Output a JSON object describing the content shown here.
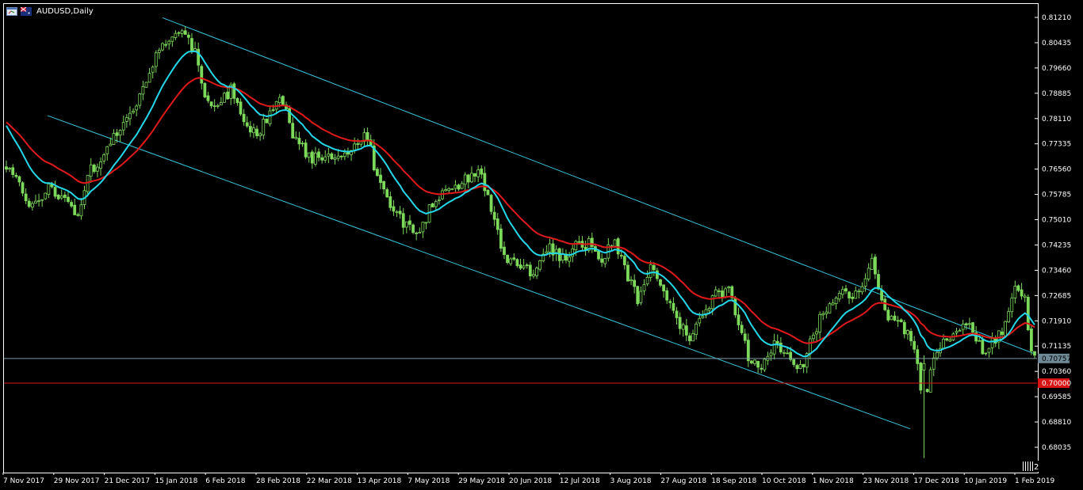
{
  "window": {
    "symbol_title": "AUDUSD,Daily",
    "icons": [
      "chart-window-icon",
      "flag-icon"
    ]
  },
  "colors": {
    "background": "#000000",
    "border": "#ffffff",
    "candle": "#7cd95a",
    "ma_fast": "#24d8ea",
    "ma_slow": "#e01a1a",
    "channel": "#37c6e0",
    "current_price_line": "#7d9aa6",
    "level_line": "#d81414"
  },
  "chart_data": {
    "type": "candlestick",
    "symbol": "AUDUSD",
    "timeframe": "Daily",
    "ylim": [
      0.6755,
      0.816
    ],
    "y_ticks": [
      "0.81210",
      "0.80435",
      "0.79660",
      "0.78885",
      "0.78110",
      "0.77335",
      "0.76560",
      "0.75785",
      "0.75010",
      "0.74235",
      "0.73460",
      "0.72685",
      "0.71910",
      "0.71135",
      "0.70360",
      "0.69585",
      "0.68810",
      "0.68035"
    ],
    "x_labels": [
      "7 Nov 2017",
      "29 Nov 2017",
      "21 Dec 2017",
      "15 Jan 2018",
      "6 Feb 2018",
      "28 Feb 2018",
      "22 Mar 2018",
      "13 Apr 2018",
      "7 May 2018",
      "29 May 2018",
      "20 Jun 2018",
      "12 Jul 2018",
      "3 Aug 2018",
      "27 Aug 2018",
      "18 Sep 2018",
      "10 Oct 2018",
      "1 Nov 2018",
      "23 Nov 2018",
      "17 Dec 2018",
      "10 Jan 2019",
      "1 Feb 2019"
    ],
    "current_price": 0.70757,
    "current_price_label": "0.70757",
    "level_price": 0.7,
    "level_label": "0.70000",
    "price_path": [
      [
        0,
        0.766
      ],
      [
        4,
        0.761
      ],
      [
        8,
        0.754
      ],
      [
        13,
        0.76
      ],
      [
        18,
        0.756
      ],
      [
        22,
        0.75
      ],
      [
        25,
        0.764
      ],
      [
        30,
        0.77
      ],
      [
        36,
        0.78
      ],
      [
        41,
        0.788
      ],
      [
        45,
        0.798
      ],
      [
        50,
        0.806
      ],
      [
        55,
        0.808
      ],
      [
        58,
        0.801
      ],
      [
        61,
        0.787
      ],
      [
        66,
        0.786
      ],
      [
        69,
        0.79
      ],
      [
        72,
        0.782
      ],
      [
        77,
        0.776
      ],
      [
        82,
        0.785
      ],
      [
        85,
        0.787
      ],
      [
        88,
        0.776
      ],
      [
        93,
        0.769
      ],
      [
        99,
        0.77
      ],
      [
        106,
        0.772
      ],
      [
        111,
        0.776
      ],
      [
        114,
        0.762
      ],
      [
        118,
        0.754
      ],
      [
        122,
        0.749
      ],
      [
        126,
        0.745
      ],
      [
        130,
        0.753
      ],
      [
        134,
        0.759
      ],
      [
        138,
        0.76
      ],
      [
        142,
        0.763
      ],
      [
        145,
        0.766
      ],
      [
        149,
        0.754
      ],
      [
        153,
        0.738
      ],
      [
        158,
        0.736
      ],
      [
        162,
        0.734
      ],
      [
        166,
        0.742
      ],
      [
        171,
        0.738
      ],
      [
        175,
        0.742
      ],
      [
        179,
        0.743
      ],
      [
        183,
        0.738
      ],
      [
        187,
        0.744
      ],
      [
        191,
        0.733
      ],
      [
        194,
        0.726
      ],
      [
        198,
        0.736
      ],
      [
        202,
        0.729
      ],
      [
        206,
        0.72
      ],
      [
        210,
        0.713
      ],
      [
        214,
        0.722
      ],
      [
        218,
        0.727
      ],
      [
        222,
        0.728
      ],
      [
        225,
        0.718
      ],
      [
        228,
        0.708
      ],
      [
        232,
        0.705
      ],
      [
        236,
        0.712
      ],
      [
        240,
        0.708
      ],
      [
        244,
        0.704
      ],
      [
        247,
        0.712
      ],
      [
        250,
        0.72
      ],
      [
        253,
        0.725
      ],
      [
        257,
        0.73
      ],
      [
        260,
        0.726
      ],
      [
        263,
        0.728
      ],
      [
        266,
        0.738
      ],
      [
        268,
        0.729
      ],
      [
        271,
        0.721
      ],
      [
        275,
        0.719
      ],
      [
        279,
        0.71
      ],
      [
        281,
        0.699
      ],
      [
        283,
        0.699
      ],
      [
        286,
        0.711
      ],
      [
        290,
        0.715
      ],
      [
        294,
        0.718
      ],
      [
        297,
        0.716
      ],
      [
        300,
        0.71
      ],
      [
        304,
        0.713
      ],
      [
        307,
        0.718
      ],
      [
        310,
        0.728
      ],
      [
        313,
        0.726
      ],
      [
        315,
        0.71
      ],
      [
        316,
        0.709
      ]
    ],
    "flash_crash_low": 0.677,
    "moving_averages": [
      {
        "period": "fast",
        "color": "#24d8ea"
      },
      {
        "period": "slow",
        "color": "#e01a1a"
      }
    ],
    "channel": {
      "upper": [
        [
          "Jan 2018",
          0.812
        ],
        [
          "Jan 2019",
          0.709
        ]
      ],
      "lower": [
        [
          "Nov 2017",
          0.782
        ],
        [
          "Jan 2019",
          0.686
        ]
      ]
    },
    "grid": false
  }
}
